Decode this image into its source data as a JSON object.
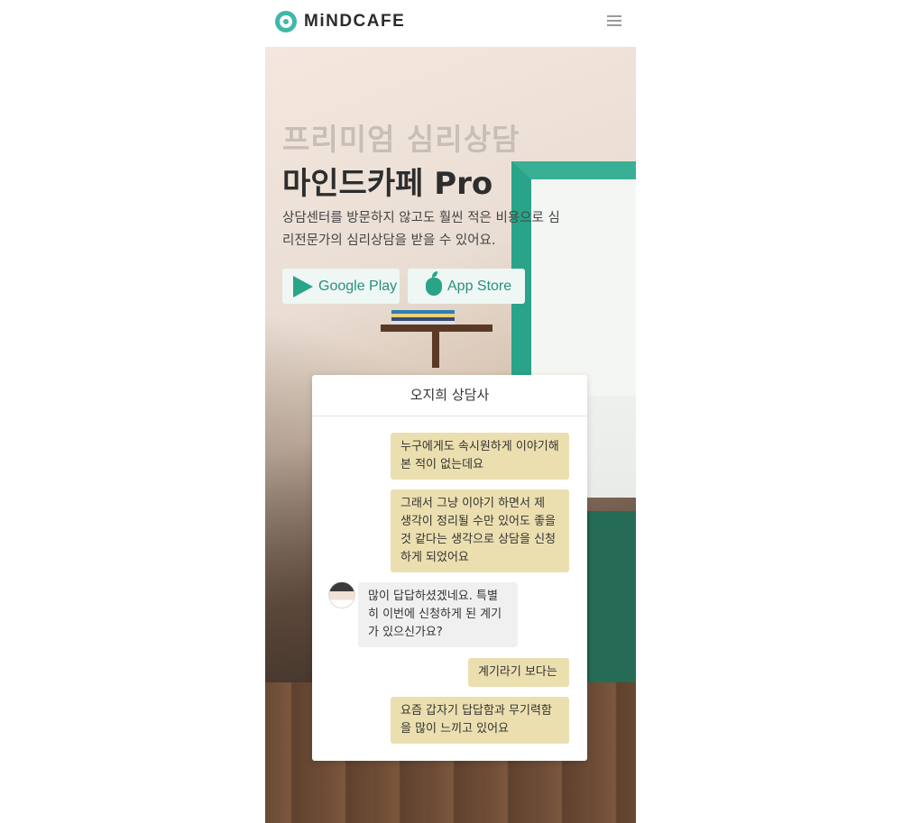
{
  "header": {
    "logo_text": "MiNDCAFE",
    "menu_icon": "hamburger-menu-icon"
  },
  "hero": {
    "subtitle": "프리미엄 심리상담",
    "title": "마인드카페 Pro",
    "description": "상담센터를 방문하지 않고도 훨씬 적은 비용으로 심리전문가의 심리상담을 받을 수 있어요.",
    "buttons": {
      "google_play": "Google Play",
      "app_store": "App Store"
    }
  },
  "chat": {
    "counselor_name": "오지희 상담사",
    "messages": [
      {
        "from": "me",
        "text": "누구에게도 속시원하게 이야기해 본 적이 없는데요"
      },
      {
        "from": "me",
        "text": "그래서 그냥 이야기 하면서 제 생각이 정리될 수만 있어도 좋을 것 같다는 생각으로 상담을 신청하게 되었어요"
      },
      {
        "from": "counselor",
        "text": "많이 답답하셨겠네요. 특별히 이번에 신청하게 된 계기가 있으신가요?"
      },
      {
        "from": "me",
        "text": "계기라기 보다는"
      },
      {
        "from": "me",
        "text": "요즘 갑자기 답답함과 무기력함을 많이 느끼고 있어요"
      }
    ]
  },
  "colors": {
    "brand": "#3fb7a9",
    "user_bubble": "#ebdfb0",
    "counselor_bubble": "#f0f0f0"
  }
}
